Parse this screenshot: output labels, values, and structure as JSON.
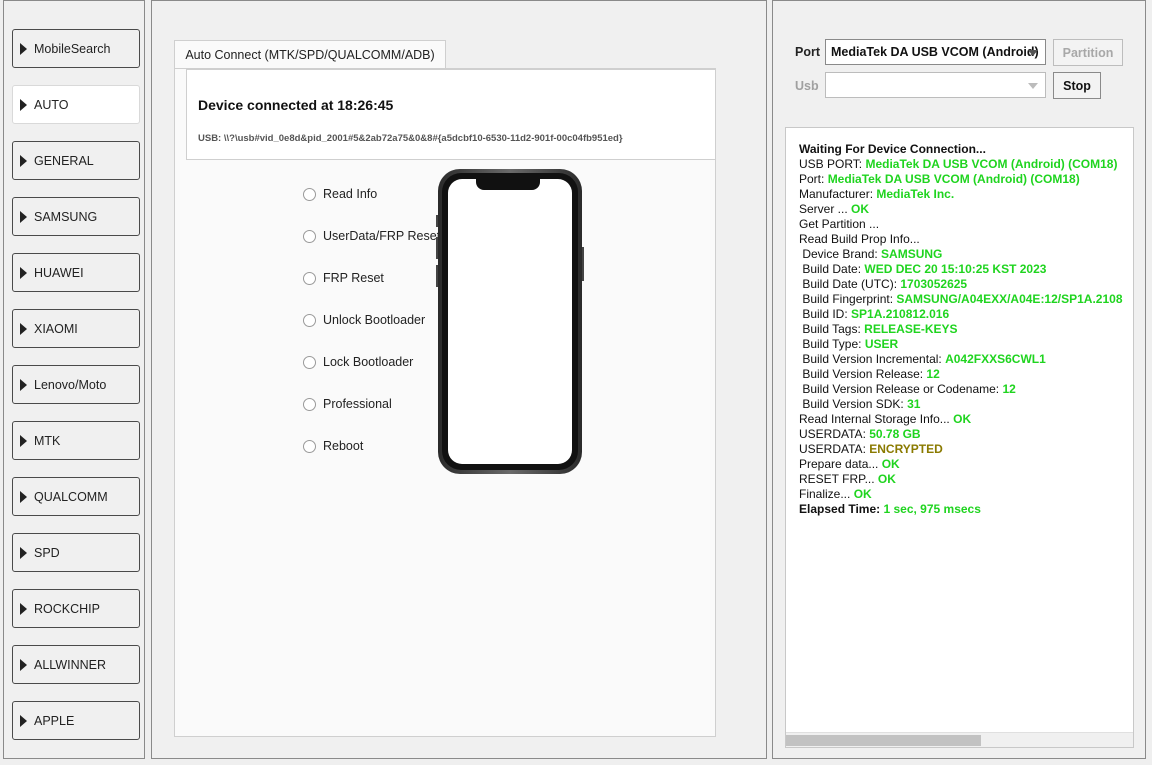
{
  "sidebar": {
    "items": [
      {
        "label": "MobileSearch",
        "active": false
      },
      {
        "label": "AUTO",
        "active": true
      },
      {
        "label": "GENERAL",
        "active": false
      },
      {
        "label": "SAMSUNG",
        "active": false
      },
      {
        "label": "HUAWEI",
        "active": false
      },
      {
        "label": "XIAOMI",
        "active": false
      },
      {
        "label": "Lenovo/Moto",
        "active": false
      },
      {
        "label": "MTK",
        "active": false
      },
      {
        "label": "QUALCOMM",
        "active": false
      },
      {
        "label": "SPD",
        "active": false
      },
      {
        "label": "ROCKCHIP",
        "active": false
      },
      {
        "label": "ALLWINNER",
        "active": false
      },
      {
        "label": "APPLE",
        "active": false
      }
    ]
  },
  "main": {
    "tab_label": "Auto Connect (MTK/SPD/QUALCOMM/ADB)",
    "device_title": "Device connected at 18:26:45",
    "usb_path": "USB: \\\\?\\usb#vid_0e8d&pid_2001#5&2ab72a75&0&8#{a5dcbf10-6530-11d2-901f-00c04fb951ed}",
    "operations": [
      {
        "label": "Read Info"
      },
      {
        "label": "UserData/FRP Reset"
      },
      {
        "label": "FRP Reset"
      },
      {
        "label": "Unlock Bootloader"
      },
      {
        "label": "Lock Bootloader"
      },
      {
        "label": "Professional"
      },
      {
        "label": "Reboot"
      }
    ]
  },
  "right": {
    "port_label": "Port",
    "port_value": "MediaTek DA USB VCOM (Android)",
    "usb_label": "Usb",
    "usb_value": "",
    "partition_label": "Partition",
    "stop_label": "Stop",
    "log": [
      {
        "k": "Waiting For Device Connection...",
        "v": "",
        "kbold": true,
        "vcolor": ""
      },
      {
        "k": "USB PORT: ",
        "v": "MediaTek DA USB VCOM (Android) (COM18)",
        "kbold": false,
        "vcolor": "#1fd41f"
      },
      {
        "k": "Port: ",
        "v": "MediaTek DA USB VCOM (Android) (COM18)",
        "kbold": false,
        "vcolor": "#1fd41f"
      },
      {
        "k": "Manufacturer: ",
        "v": "MediaTek Inc.",
        "kbold": false,
        "vcolor": "#1fd41f"
      },
      {
        "k": "Server ... ",
        "v": "OK",
        "kbold": false,
        "vcolor": "#1fd41f"
      },
      {
        "k": "Get Partition ...",
        "v": "",
        "kbold": false,
        "vcolor": ""
      },
      {
        "k": "Read Build Prop Info...",
        "v": "",
        "kbold": false,
        "vcolor": ""
      },
      {
        "k": " Device Brand: ",
        "v": "SAMSUNG",
        "kbold": false,
        "vcolor": "#1fd41f"
      },
      {
        "k": " Build Date: ",
        "v": "WED DEC 20 15:10:25 KST 2023",
        "kbold": false,
        "vcolor": "#1fd41f"
      },
      {
        "k": " Build Date (UTC): ",
        "v": "1703052625",
        "kbold": false,
        "vcolor": "#1fd41f"
      },
      {
        "k": " Build Fingerprint: ",
        "v": "SAMSUNG/A04EXX/A04E:12/SP1A.2108",
        "kbold": false,
        "vcolor": "#1fd41f"
      },
      {
        "k": " Build ID: ",
        "v": "SP1A.210812.016",
        "kbold": false,
        "vcolor": "#1fd41f"
      },
      {
        "k": " Build Tags: ",
        "v": "RELEASE-KEYS",
        "kbold": false,
        "vcolor": "#1fd41f"
      },
      {
        "k": " Build Type: ",
        "v": "USER",
        "kbold": false,
        "vcolor": "#1fd41f"
      },
      {
        "k": " Build Version Incremental: ",
        "v": "A042FXXS6CWL1",
        "kbold": false,
        "vcolor": "#1fd41f"
      },
      {
        "k": " Build Version Release: ",
        "v": "12",
        "kbold": false,
        "vcolor": "#1fd41f"
      },
      {
        "k": " Build Version Release or Codename: ",
        "v": "12",
        "kbold": false,
        "vcolor": "#1fd41f"
      },
      {
        "k": " Build Version SDK: ",
        "v": "31",
        "kbold": false,
        "vcolor": "#1fd41f"
      },
      {
        "k": "Read Internal Storage Info... ",
        "v": "OK",
        "kbold": false,
        "vcolor": "#1fd41f"
      },
      {
        "k": "USERDATA: ",
        "v": "50.78 GB",
        "kbold": false,
        "vcolor": "#1fd41f"
      },
      {
        "k": "USERDATA: ",
        "v": "ENCRYPTED",
        "kbold": false,
        "vcolor": "#8a7a00"
      },
      {
        "k": "Prepare data... ",
        "v": "OK",
        "kbold": false,
        "vcolor": "#1fd41f"
      },
      {
        "k": "RESET FRP... ",
        "v": "OK",
        "kbold": false,
        "vcolor": "#1fd41f"
      },
      {
        "k": "Finalize... ",
        "v": "OK",
        "kbold": false,
        "vcolor": "#1fd41f"
      },
      {
        "k": "Elapsed Time: ",
        "v": "1 sec, 975 msecs",
        "kbold": true,
        "vcolor": "#1fd41f"
      }
    ]
  }
}
